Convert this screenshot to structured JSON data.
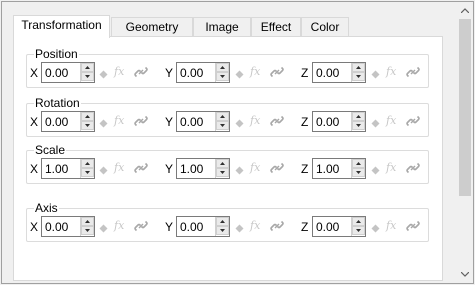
{
  "tabs": [
    {
      "label": "Transformation",
      "active": true
    },
    {
      "label": "Geometry",
      "active": false
    },
    {
      "label": "Image",
      "active": false
    },
    {
      "label": "Effect",
      "active": false
    },
    {
      "label": "Color",
      "active": false
    }
  ],
  "groups": {
    "position": {
      "title": "Position",
      "fields": [
        {
          "axis": "X",
          "value": "0.00"
        },
        {
          "axis": "Y",
          "value": "0.00"
        },
        {
          "axis": "Z",
          "value": "0.00"
        }
      ]
    },
    "rotation": {
      "title": "Rotation",
      "fields": [
        {
          "axis": "X",
          "value": "0.00"
        },
        {
          "axis": "Y",
          "value": "0.00"
        },
        {
          "axis": "Z",
          "value": "0.00"
        }
      ]
    },
    "scale": {
      "title": "Scale",
      "fields": [
        {
          "axis": "X",
          "value": "1.00"
        },
        {
          "axis": "Y",
          "value": "1.00"
        },
        {
          "axis": "Z",
          "value": "1.00"
        }
      ]
    },
    "axis": {
      "title": "Axis",
      "fields": [
        {
          "axis": "X",
          "value": "0.00"
        },
        {
          "axis": "Y",
          "value": "0.00"
        },
        {
          "axis": "Z",
          "value": "0.00"
        }
      ]
    }
  },
  "icons": {
    "keyframe": "diamond-keyframe-icon",
    "expression": "fx-expression-icon",
    "link": "chain-link-icon",
    "fx_text": "fx"
  },
  "colors": {
    "window_bg": "#f0f0f0",
    "page_bg": "#ffffff",
    "border": "#d9d9d9",
    "disabled_icon": "#c8c8c8"
  }
}
